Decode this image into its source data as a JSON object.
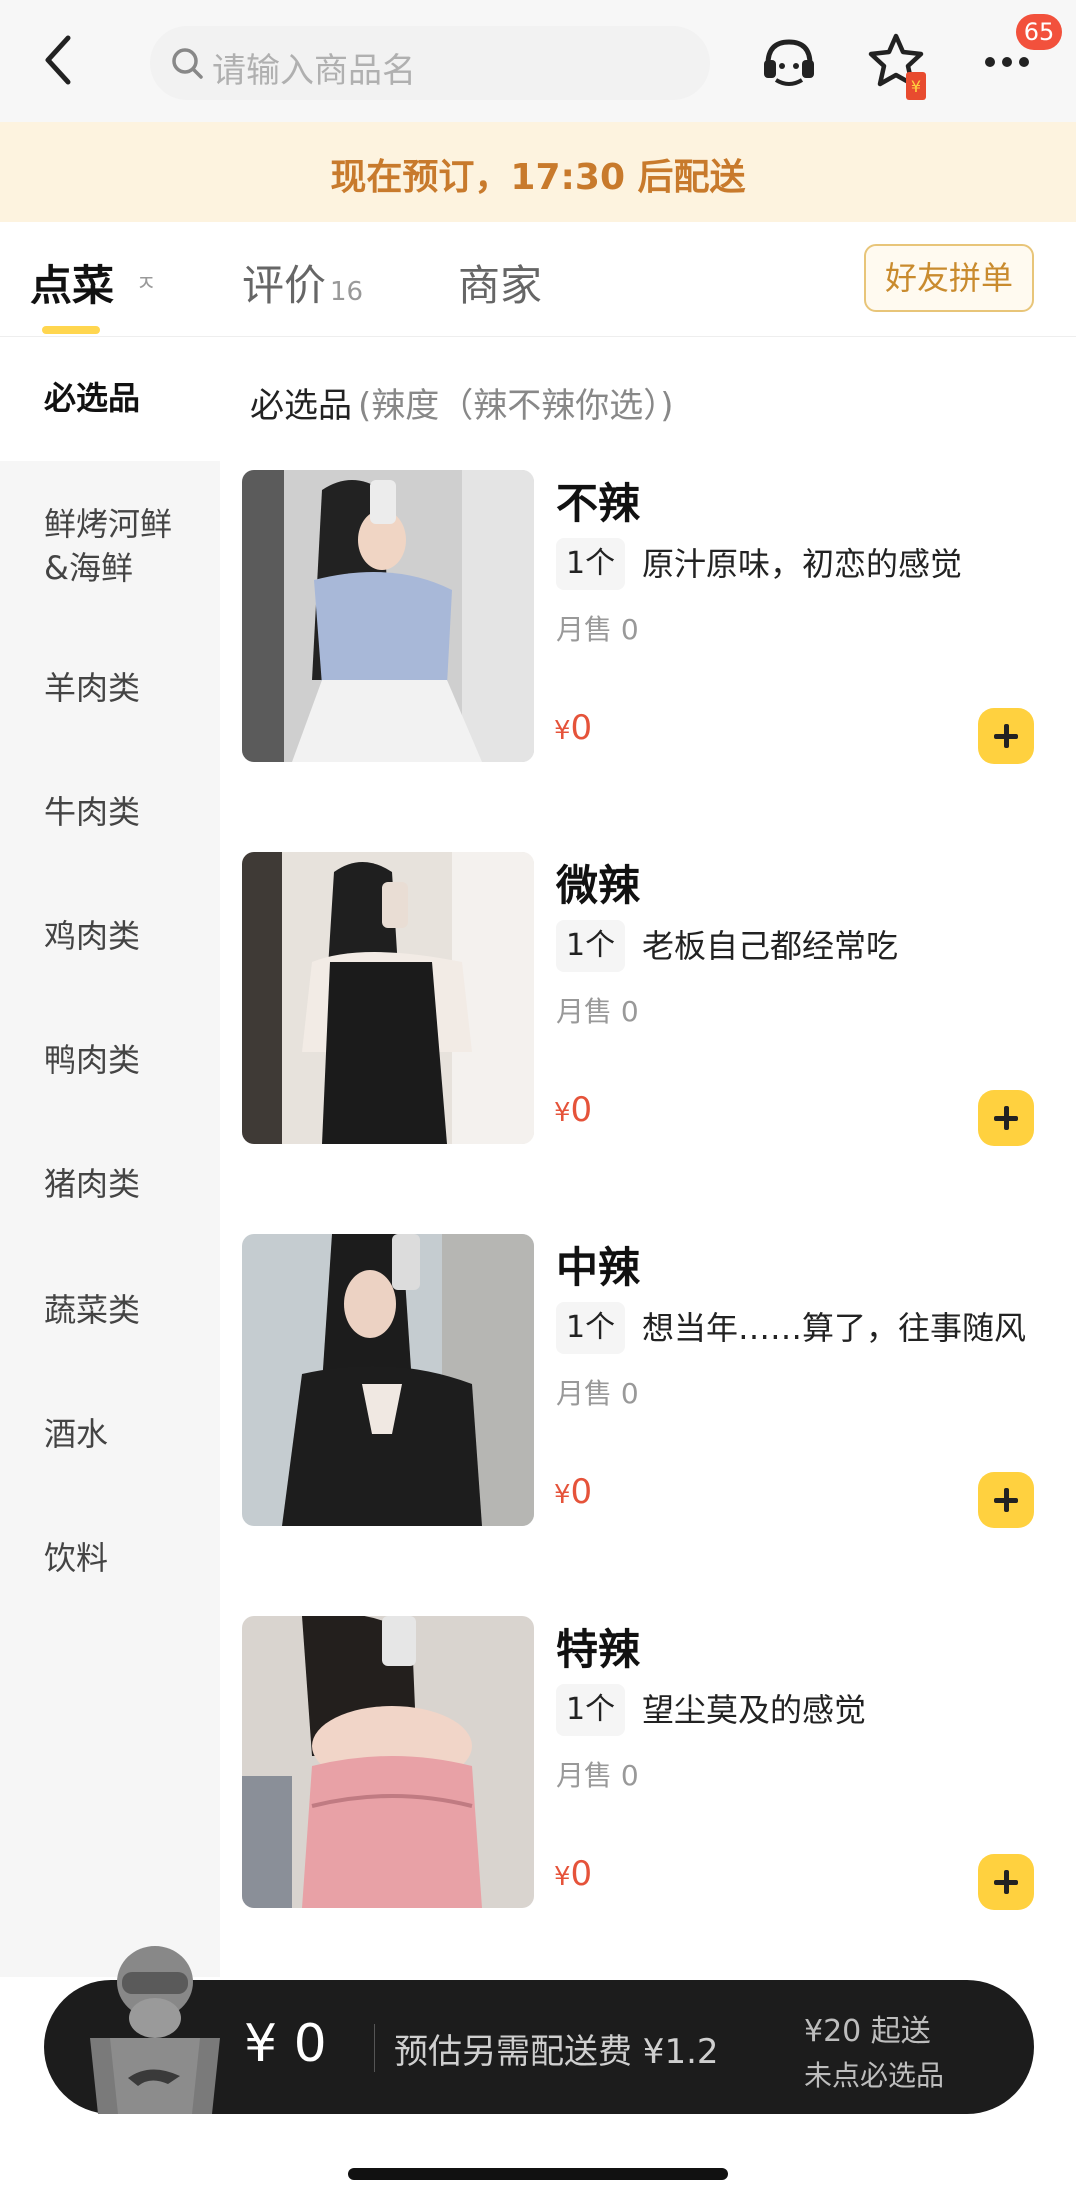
{
  "search": {
    "placeholder": "请输入商品名"
  },
  "header": {
    "badge_count": "65"
  },
  "banner": {
    "text": "现在预订，17:30 后配送"
  },
  "tabs": [
    {
      "label": "点菜",
      "sort_mark": "ㅈ"
    },
    {
      "label": "评价",
      "count": "16"
    },
    {
      "label": "商家"
    }
  ],
  "friend_order": {
    "label": "好友拼单"
  },
  "sidebar": {
    "items": [
      "必选品",
      "鲜烤河鲜&海鲜",
      "羊肉类",
      "牛肉类",
      "鸡肉类",
      "鸭肉类",
      "猪肉类",
      "蔬菜类",
      "酒水",
      "饮料"
    ]
  },
  "section": {
    "title": "必选品",
    "subtitle": "(辣度（辣不辣你选）)"
  },
  "products": [
    {
      "name": "不辣",
      "qty": "1个",
      "desc": "原汁原味，初恋的感觉",
      "sold": "月售 0",
      "price_symbol": "¥",
      "price": "0"
    },
    {
      "name": "微辣",
      "qty": "1个",
      "desc": "老板自己都经常吃",
      "sold": "月售 0",
      "price_symbol": "¥",
      "price": "0"
    },
    {
      "name": "中辣",
      "qty": "1个",
      "desc": "想当年……算了，往事随风",
      "sold": "月售 0",
      "price_symbol": "¥",
      "price": "0"
    },
    {
      "name": "特辣",
      "qty": "1个",
      "desc": "望尘莫及的感觉",
      "sold": "月售 0",
      "price_symbol": "¥",
      "price": "0"
    }
  ],
  "cart": {
    "price": "¥ 0",
    "fee": "预估另需配送费 ¥1.2",
    "min_order": "¥20 起送",
    "note": "未点必选品"
  },
  "colors": {
    "accent": "#ffd13f",
    "banner_bg": "#fdf3df",
    "banner_text": "#c87a2c",
    "price": "#e5533a",
    "cart_bg": "#1c1c1c"
  }
}
